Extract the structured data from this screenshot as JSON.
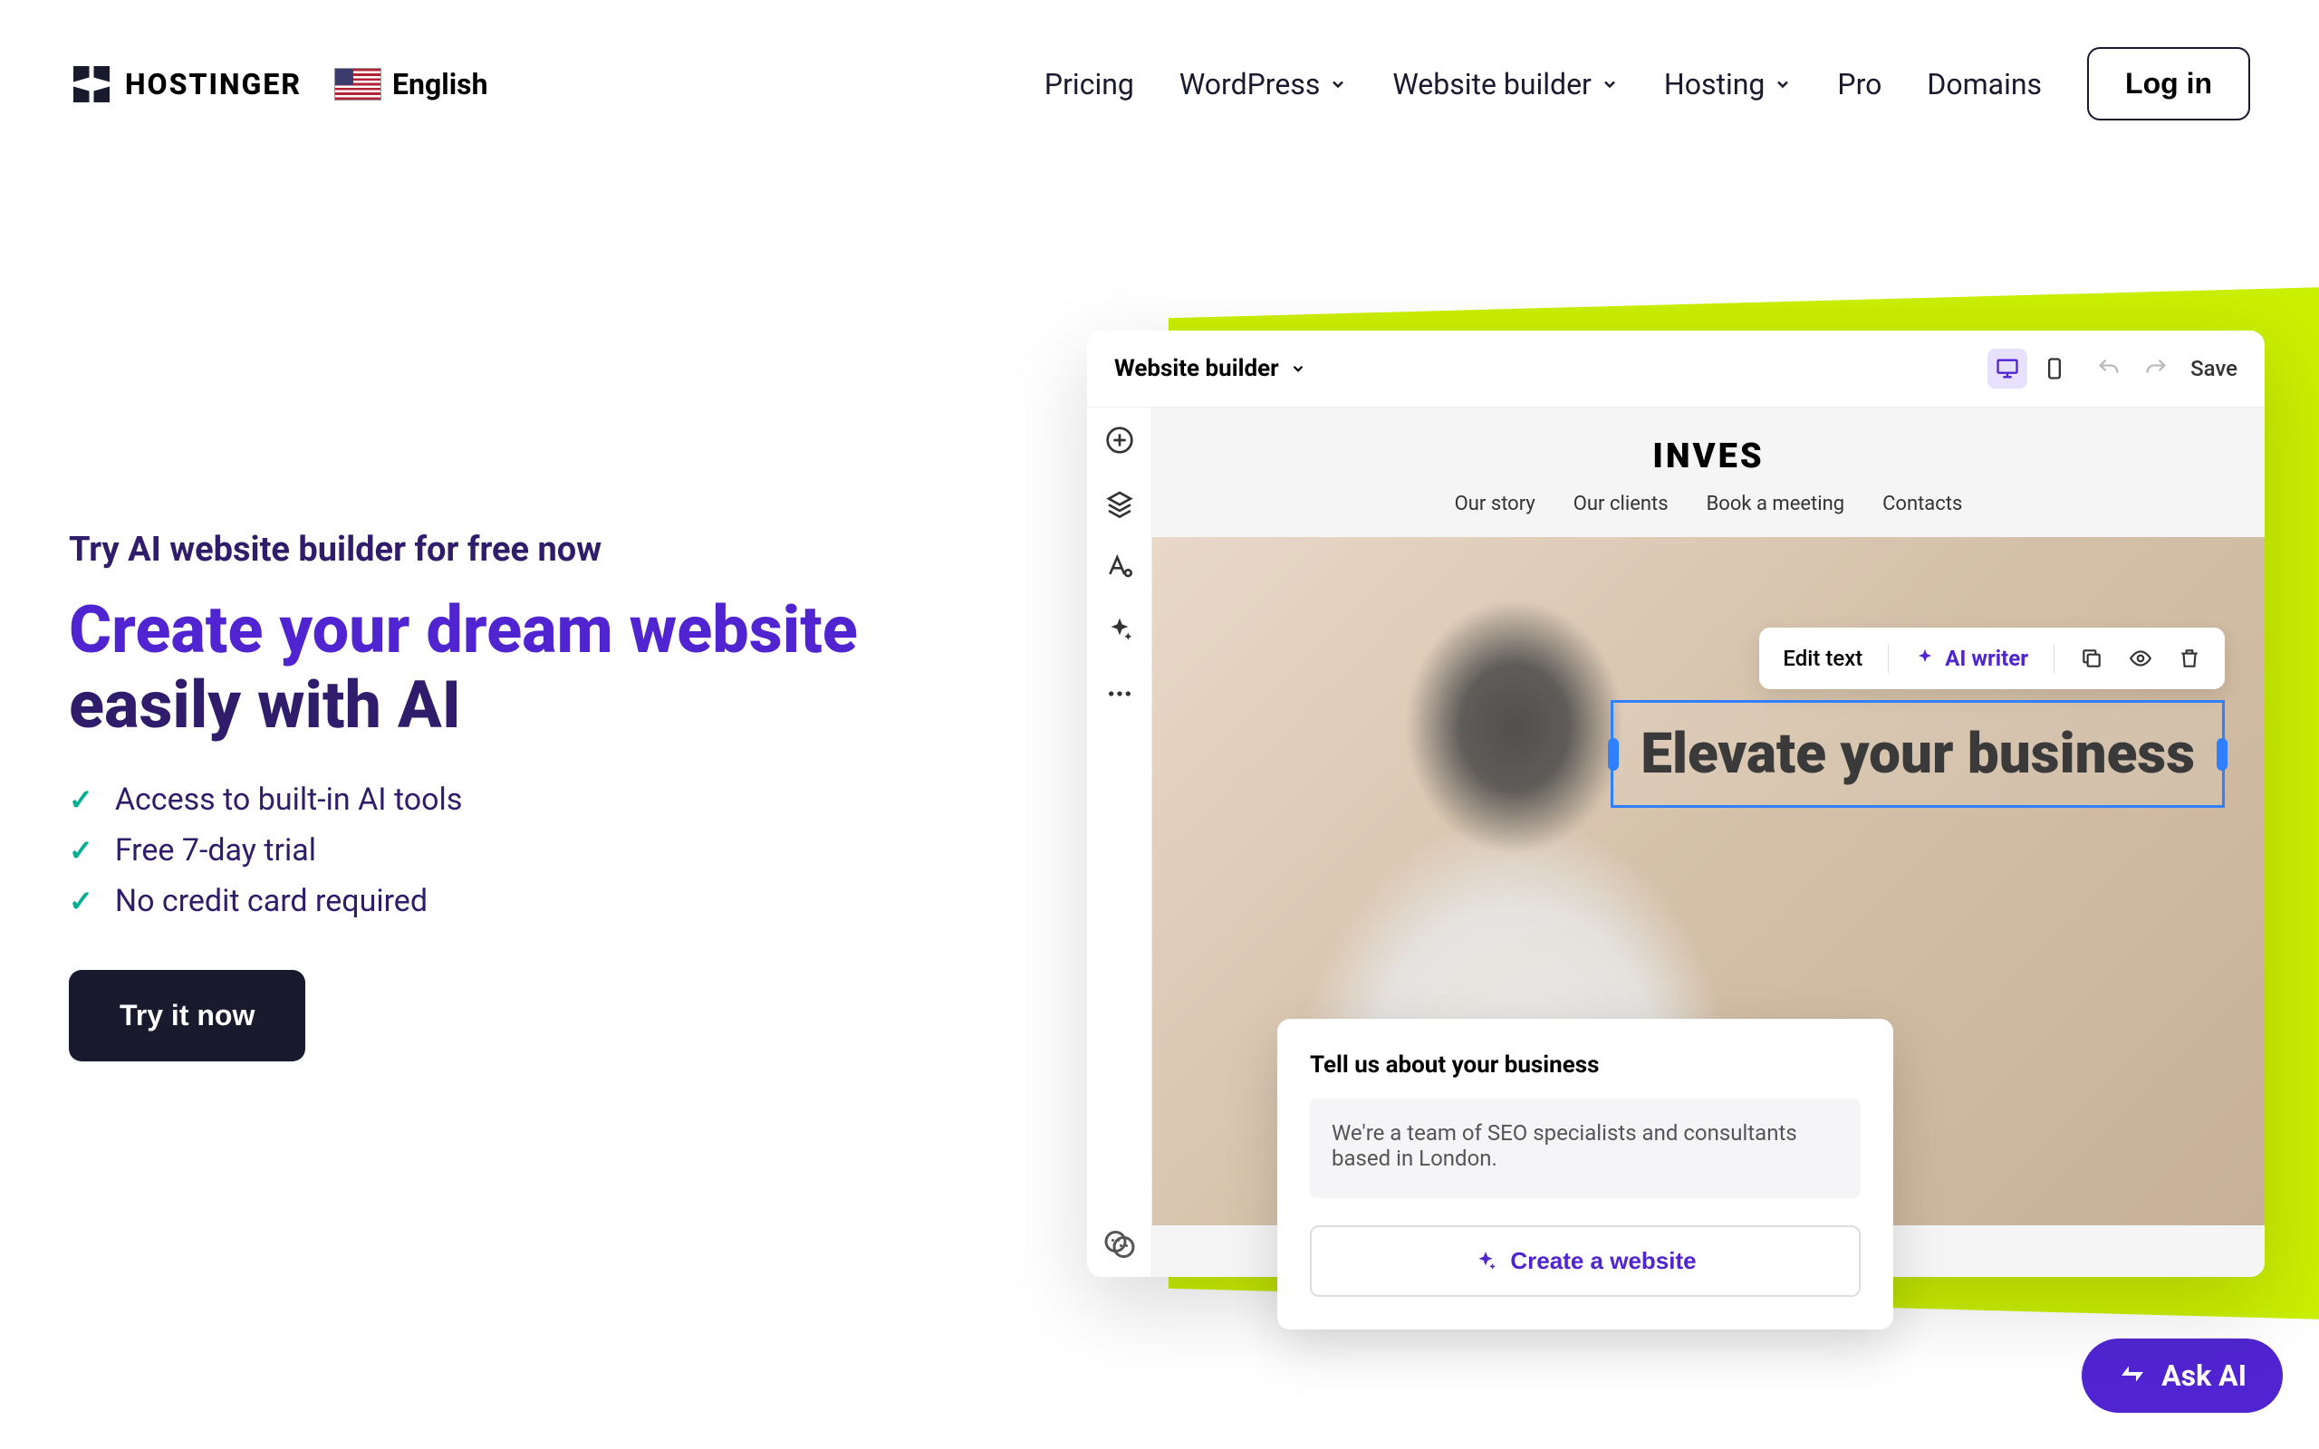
{
  "brand": "HOSTINGER",
  "language": "English",
  "nav": {
    "pricing": "Pricing",
    "wordpress": "WordPress",
    "website_builder": "Website builder",
    "hosting": "Hosting",
    "pro": "Pro",
    "domains": "Domains",
    "login": "Log in"
  },
  "hero": {
    "subtitle": "Try AI website builder for free now",
    "title_purple": "Create your dream website",
    "title_dark": " easily with AI",
    "features": [
      "Access to built-in AI tools",
      "Free 7-day trial",
      "No credit card required"
    ],
    "cta": "Try it now"
  },
  "builder": {
    "dropdown": "Website builder",
    "save": "Save",
    "site_logo": "INVES",
    "site_nav": [
      "Our story",
      "Our clients",
      "Book a meeting",
      "Contacts"
    ],
    "edit_text": "Edit text",
    "ai_writer": "AI writer",
    "headline": "Elevate your business",
    "prompt_label": "Tell us about your business",
    "prompt_value": "We're a team of SEO specialists and consultants based in London.",
    "create_btn": "Create a website"
  },
  "ask_ai": "Ask AI"
}
